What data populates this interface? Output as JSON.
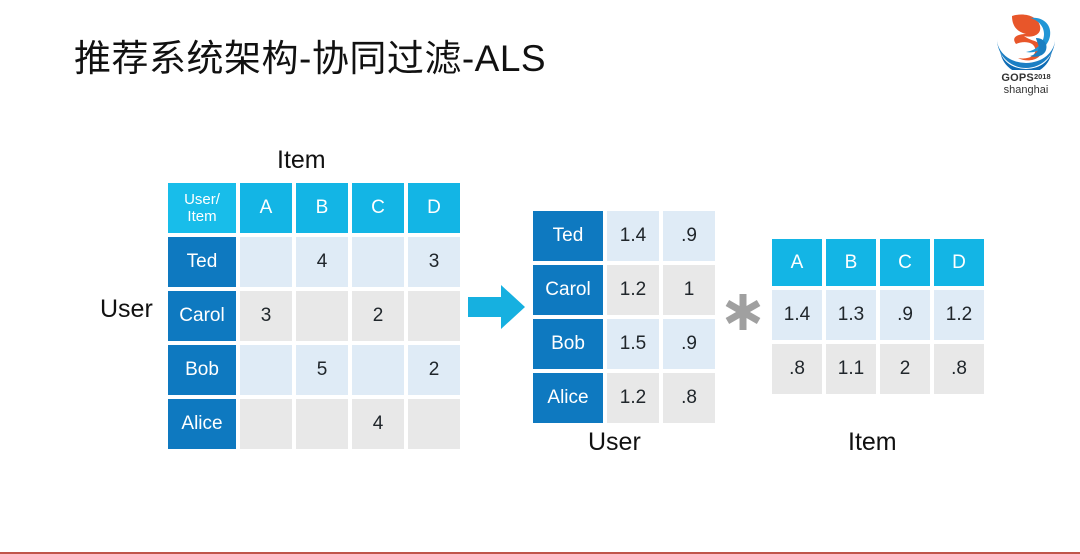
{
  "slide": {
    "title": "推荐系统架构-协同过滤-ALS"
  },
  "logo": {
    "brand": "GOPS",
    "year": "2018",
    "city": "shanghai",
    "icon": "gops-swirl-logo"
  },
  "labels": {
    "user_left": "User",
    "item_top": "Item",
    "user_mid": "User",
    "item_right": "Item"
  },
  "symbols": {
    "arrow": "right-arrow-icon",
    "multiply": "asterisk-multiply-icon"
  },
  "colors": {
    "header_cyan": "#13b5e5",
    "rowname_blue": "#0e79c0",
    "cell_blue": "#dfebf6",
    "cell_gray": "#e8e8e8",
    "arrow_cyan": "#16b0e0",
    "asterisk_gray": "#a0a0a0",
    "title_text": "#111111"
  },
  "chart_data": {
    "type": "table",
    "title": "推荐系统架构-协同过滤-ALS",
    "matrices": [
      {
        "name": "ratings-matrix",
        "row_axis_label": "User",
        "col_axis_label": "Item",
        "corner_label_line1": "User/",
        "corner_label_line2": "Item",
        "columns": [
          "A",
          "B",
          "C",
          "D"
        ],
        "rows": [
          {
            "name": "Ted",
            "values": [
              "",
              "4",
              "",
              "3"
            ]
          },
          {
            "name": "Carol",
            "values": [
              "3",
              "",
              "2",
              ""
            ]
          },
          {
            "name": "Bob",
            "values": [
              "",
              "5",
              "",
              "2"
            ]
          },
          {
            "name": "Alice",
            "values": [
              "",
              "",
              "4",
              ""
            ]
          }
        ]
      },
      {
        "name": "user-factor-matrix",
        "caption": "User",
        "rows": [
          {
            "name": "Ted",
            "values": [
              "1.4",
              ".9"
            ]
          },
          {
            "name": "Carol",
            "values": [
              "1.2",
              "1"
            ]
          },
          {
            "name": "Bob",
            "values": [
              "1.5",
              ".9"
            ]
          },
          {
            "name": "Alice",
            "values": [
              "1.2",
              ".8"
            ]
          }
        ]
      },
      {
        "name": "item-factor-matrix",
        "caption": "Item",
        "columns": [
          "A",
          "B",
          "C",
          "D"
        ],
        "rows": [
          {
            "values": [
              "1.4",
              "1.3",
              ".9",
              "1.2"
            ]
          },
          {
            "values": [
              ".8",
              "1.1",
              "2",
              ".8"
            ]
          }
        ]
      }
    ]
  }
}
